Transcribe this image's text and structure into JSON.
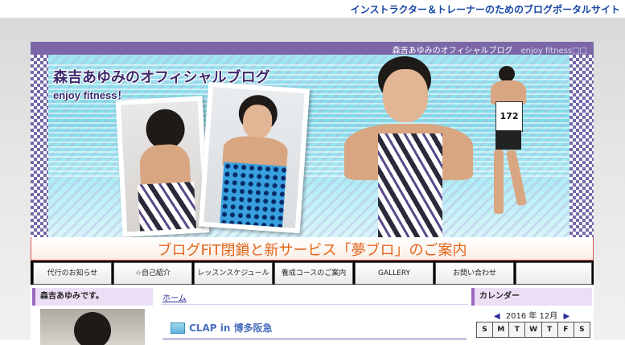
{
  "portal": {
    "tagline": "インストラクター＆トレーナーのためのブログポータルサイト"
  },
  "header": {
    "ribbon_title": "森吉あゆみのオフィシャルブログ",
    "ribbon_sub": "enjoy fitness□□",
    "title": "森吉あゆみのオフィシャルブログ",
    "subtitle": "enjoy fitness！",
    "bib_number": "172",
    "notice": "ブログFiT閉鎖と新サービス「夢ブロ」のご案内",
    "colors": {
      "ribbon": "#7b67a8",
      "notice_text": "#e1651a",
      "title": "#3b2a6d"
    }
  },
  "nav": {
    "items": [
      {
        "label": "代行のお知らせ"
      },
      {
        "label": "☆自己紹介"
      },
      {
        "label": "レッスンスケジュール"
      },
      {
        "label": "養成コースのご案内"
      },
      {
        "label": "GALLERY"
      },
      {
        "label": "お問い合わせ"
      },
      {
        "label": ""
      }
    ]
  },
  "sidebar_left": {
    "title": "森吉あゆみです。"
  },
  "main": {
    "breadcrumb": "ホーム",
    "post_title": "CLAP in 博多阪急",
    "post_icon": "folder-icon"
  },
  "calendar": {
    "title": "カレンダー",
    "prev": "◀",
    "next": "▶",
    "month_label": "2016 年 12月",
    "weekdays": [
      "S",
      "M",
      "T",
      "W",
      "T",
      "F",
      "S"
    ]
  }
}
